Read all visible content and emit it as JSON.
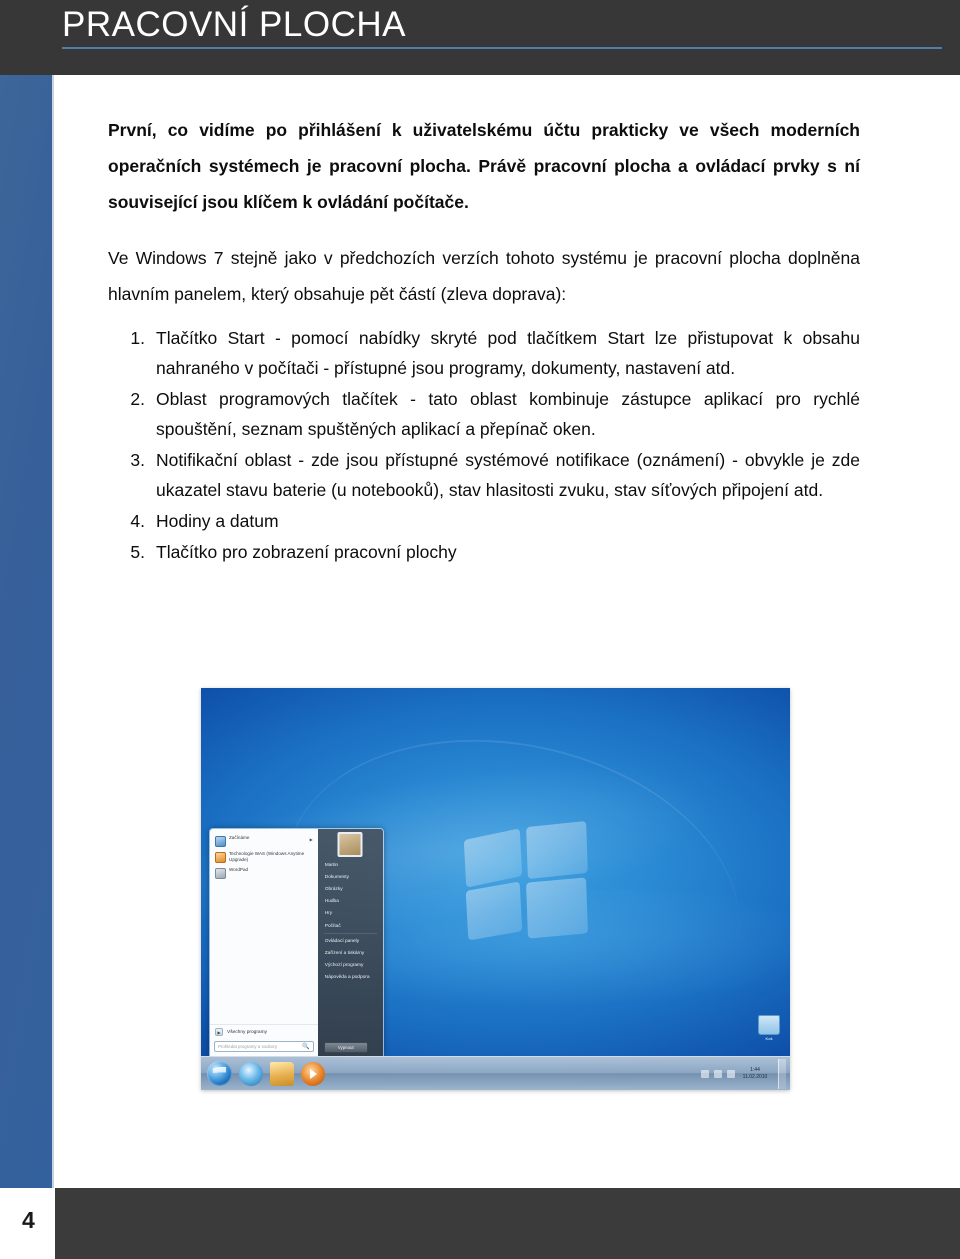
{
  "header": {
    "title": "PRACOVNÍ PLOCHA"
  },
  "footer": {
    "page_number": "4"
  },
  "content": {
    "intro_paragraph": "První, co vidíme po přihlášení k uživatelskému účtu prakticky ve všech moderních operačních systémech je pracovní plocha. Právě pracovní plocha a ovládací prvky s ní související jsou klíčem k ovládání počítače.",
    "secondary_paragraph": "Ve Windows 7 stejně jako v předchozích verzích tohoto systému je pracovní plocha doplněna hlavním panelem, který obsahuje pět částí (zleva doprava):",
    "list": [
      {
        "number": "1.",
        "text": "Tlačítko Start - pomocí nabídky skryté pod tlačítkem Start lze přistupovat k obsahu nahraného v počítači - přístupné jsou programy, dokumenty, nastavení atd."
      },
      {
        "number": "2.",
        "text": "Oblast programových tlačítek - tato oblast kombinuje zástupce aplikací pro rychlé spouštění, seznam spuštěných aplikací a přepínač oken."
      },
      {
        "number": "3.",
        "text": "Notifikační oblast - zde jsou přístupné systémové notifikace (oznámení) - obvykle je zde ukazatel stavu baterie (u notebooků), stav hlasitosti zvuku, stav síťových připojení atd."
      },
      {
        "number": "4.",
        "text": "Hodiny a datum"
      },
      {
        "number": "5.",
        "text": "Tlačítko pro zobrazení pracovní plochy"
      }
    ]
  },
  "figure": {
    "caption_alt": "Windows 7 pracovní plocha s otevřenou nabídkou Start",
    "desktop": {
      "recycle_bin_label": "Koš"
    },
    "start_menu": {
      "programs": [
        {
          "label": "Začínáme",
          "icon": "getting-started-icon",
          "has_submenu": true
        },
        {
          "label": "Technologie WAS (Windows Anytime Upgrade)",
          "icon": "upgrade-icon",
          "has_submenu": false
        },
        {
          "label": "WordPad",
          "icon": "wordpad-icon",
          "has_submenu": false
        }
      ],
      "all_programs_label": "Všechny programy",
      "search_placeholder": "Prohledat programy a soubory",
      "user_name": "Martin",
      "right_items": [
        "Martin",
        "Dokumenty",
        "Obrázky",
        "Hudba",
        "Hry",
        "Počítač",
        "Ovládací panely",
        "Zařízení a tiskárny",
        "Výchozí programy",
        "Nápověda a podpora"
      ],
      "shutdown_label": "Vypnout"
    },
    "taskbar": {
      "buttons": [
        {
          "name": "start-orb",
          "label": "Start"
        },
        {
          "name": "internet-explorer",
          "label": "Internet Explorer"
        },
        {
          "name": "windows-explorer",
          "label": "Průzkumník Windows"
        },
        {
          "name": "windows-media-player",
          "label": "Windows Media Player"
        }
      ],
      "clock_time": "1:44",
      "clock_date": "11.02.2010"
    }
  },
  "colors": {
    "header_bg": "#373737",
    "header_rule": "#4e7fae",
    "side_strip": "#3a639c",
    "footer_bg": "#3b3b3b",
    "text": "#0d0d0d"
  }
}
